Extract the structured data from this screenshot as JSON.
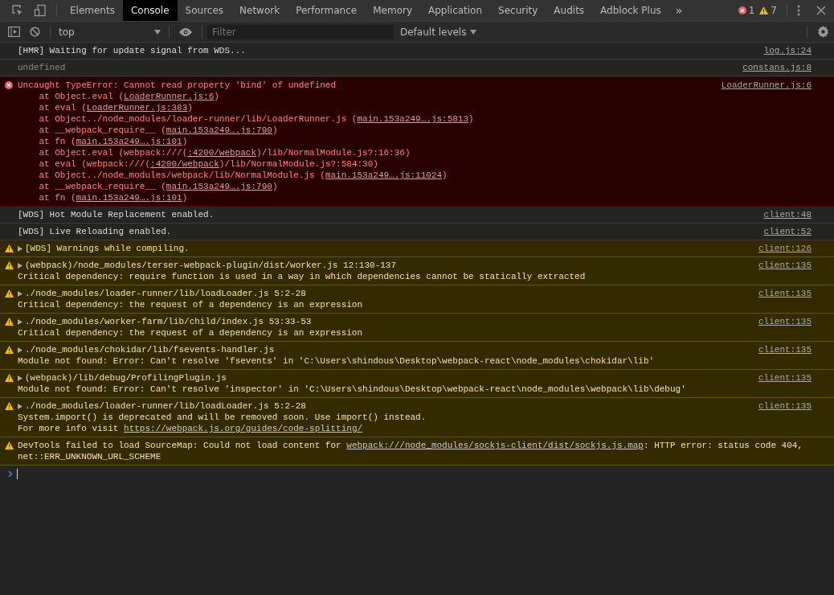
{
  "tabs": [
    {
      "label": "Elements",
      "selected": false
    },
    {
      "label": "Console",
      "selected": true
    },
    {
      "label": "Sources",
      "selected": false
    },
    {
      "label": "Network",
      "selected": false
    },
    {
      "label": "Performance",
      "selected": false
    },
    {
      "label": "Memory",
      "selected": false
    },
    {
      "label": "Application",
      "selected": false
    },
    {
      "label": "Security",
      "selected": false
    },
    {
      "label": "Audits",
      "selected": false
    },
    {
      "label": "Adblock Plus",
      "selected": false
    }
  ],
  "overflow": "»",
  "counters": {
    "errors": "1",
    "warnings": "7"
  },
  "toolbar": {
    "context": "top",
    "filter_placeholder": "Filter",
    "levels": "Default levels"
  },
  "messages": [
    {
      "kind": "log",
      "expandable": false,
      "source": "log.js:24",
      "lines": [
        [
          {
            "kind": "text",
            "text": "[HMR] Waiting for update signal from WDS..."
          }
        ]
      ]
    },
    {
      "kind": "result",
      "expandable": false,
      "source": "constans.js:8",
      "lines": [
        [
          {
            "kind": "text",
            "text": "undefined"
          }
        ]
      ]
    },
    {
      "kind": "error",
      "expandable": false,
      "source": "LoaderRunner.js:6",
      "lines": [
        [
          {
            "kind": "text",
            "text": "Uncaught TypeError: Cannot read property 'bind' of undefined"
          }
        ],
        [
          {
            "kind": "text",
            "text": "    at Object.eval ("
          },
          {
            "kind": "link",
            "text": "LoaderRunner.js:6"
          },
          {
            "kind": "text",
            "text": ")"
          }
        ],
        [
          {
            "kind": "text",
            "text": "    at eval ("
          },
          {
            "kind": "link",
            "text": "LoaderRunner.js:383"
          },
          {
            "kind": "text",
            "text": ")"
          }
        ],
        [
          {
            "kind": "text",
            "text": "    at Object../node_modules/loader-runner/lib/LoaderRunner.js ("
          },
          {
            "kind": "link",
            "text": "main.153a249….js:5813"
          },
          {
            "kind": "text",
            "text": ")"
          }
        ],
        [
          {
            "kind": "text",
            "text": "    at __webpack_require__ ("
          },
          {
            "kind": "link",
            "text": "main.153a249….js:790"
          },
          {
            "kind": "text",
            "text": ")"
          }
        ],
        [
          {
            "kind": "text",
            "text": "    at fn ("
          },
          {
            "kind": "link",
            "text": "main.153a249….js:101"
          },
          {
            "kind": "text",
            "text": ")"
          }
        ],
        [
          {
            "kind": "text",
            "text": "    at Object.eval (webpack:///("
          },
          {
            "kind": "link",
            "text": ":4200/webpack"
          },
          {
            "kind": "text",
            "text": ")/lib/NormalModule.js?:16:36)"
          }
        ],
        [
          {
            "kind": "text",
            "text": "    at eval (webpack:///("
          },
          {
            "kind": "link",
            "text": ":4200/webpack"
          },
          {
            "kind": "text",
            "text": ")/lib/NormalModule.js?:584:30)"
          }
        ],
        [
          {
            "kind": "text",
            "text": "    at Object../node_modules/webpack/lib/NormalModule.js ("
          },
          {
            "kind": "link",
            "text": "main.153a249….js:11024"
          },
          {
            "kind": "text",
            "text": ")"
          }
        ],
        [
          {
            "kind": "text",
            "text": "    at __webpack_require__ ("
          },
          {
            "kind": "link",
            "text": "main.153a249….js:790"
          },
          {
            "kind": "text",
            "text": ")"
          }
        ],
        [
          {
            "kind": "text",
            "text": "    at fn ("
          },
          {
            "kind": "link",
            "text": "main.153a249….js:101"
          },
          {
            "kind": "text",
            "text": ")"
          }
        ]
      ]
    },
    {
      "kind": "log",
      "expandable": false,
      "source": "client:48",
      "lines": [
        [
          {
            "kind": "text",
            "text": "[WDS] Hot Module Replacement enabled."
          }
        ]
      ]
    },
    {
      "kind": "log",
      "expandable": false,
      "source": "client:52",
      "lines": [
        [
          {
            "kind": "text",
            "text": "[WDS] Live Reloading enabled."
          }
        ]
      ]
    },
    {
      "kind": "warning",
      "expandable": true,
      "source": "client:126",
      "lines": [
        [
          {
            "kind": "text",
            "text": "[WDS] Warnings while compiling."
          }
        ]
      ]
    },
    {
      "kind": "warning",
      "expandable": true,
      "source": "client:135",
      "lines": [
        [
          {
            "kind": "text",
            "text": "(webpack)/node_modules/terser-webpack-plugin/dist/worker.js 12:130-137"
          }
        ],
        [
          {
            "kind": "text",
            "text": "Critical dependency: require function is used in a way in which dependencies cannot be statically extracted"
          }
        ]
      ]
    },
    {
      "kind": "warning",
      "expandable": true,
      "source": "client:135",
      "lines": [
        [
          {
            "kind": "text",
            "text": "./node_modules/loader-runner/lib/loadLoader.js 5:2-28"
          }
        ],
        [
          {
            "kind": "text",
            "text": "Critical dependency: the request of a dependency is an expression"
          }
        ]
      ]
    },
    {
      "kind": "warning",
      "expandable": true,
      "source": "client:135",
      "lines": [
        [
          {
            "kind": "text",
            "text": "./node_modules/worker-farm/lib/child/index.js 53:33-53"
          }
        ],
        [
          {
            "kind": "text",
            "text": "Critical dependency: the request of a dependency is an expression"
          }
        ]
      ]
    },
    {
      "kind": "warning",
      "expandable": true,
      "source": "client:135",
      "lines": [
        [
          {
            "kind": "text",
            "text": "./node_modules/chokidar/lib/fsevents-handler.js"
          }
        ],
        [
          {
            "kind": "text",
            "text": "Module not found: Error: Can't resolve 'fsevents' in 'C:\\Users\\shindous\\Desktop\\webpack-react\\node_modules\\chokidar\\lib'"
          }
        ]
      ]
    },
    {
      "kind": "warning",
      "expandable": true,
      "source": "client:135",
      "lines": [
        [
          {
            "kind": "text",
            "text": "(webpack)/lib/debug/ProfilingPlugin.js"
          }
        ],
        [
          {
            "kind": "text",
            "text": "Module not found: Error: Can't resolve 'inspector' in 'C:\\Users\\shindous\\Desktop\\webpack-react\\node_modules\\webpack\\lib\\debug'"
          }
        ]
      ]
    },
    {
      "kind": "warning",
      "expandable": true,
      "source": "client:135",
      "lines": [
        [
          {
            "kind": "text",
            "text": "./node_modules/loader-runner/lib/loadLoader.js 5:2-28"
          }
        ],
        [
          {
            "kind": "text",
            "text": "System.import() is deprecated and will be removed soon. Use import() instead."
          }
        ],
        [
          {
            "kind": "text",
            "text": "For more info visit "
          },
          {
            "kind": "link",
            "text": "https://webpack.js.org/guides/code-splitting/"
          }
        ]
      ]
    },
    {
      "kind": "warning",
      "expandable": false,
      "lines": [
        [
          {
            "kind": "text",
            "text": "DevTools failed to load SourceMap: Could not load content for "
          },
          {
            "kind": "link",
            "text": "webpack:///node_modules/sockjs-client/dist/sockjs.js.map"
          },
          {
            "kind": "text",
            "text": ": HTTP error: status code 404,"
          }
        ],
        [
          {
            "kind": "text",
            "text": "net::ERR_UNKNOWN_URL_SCHEME"
          }
        ]
      ]
    }
  ]
}
